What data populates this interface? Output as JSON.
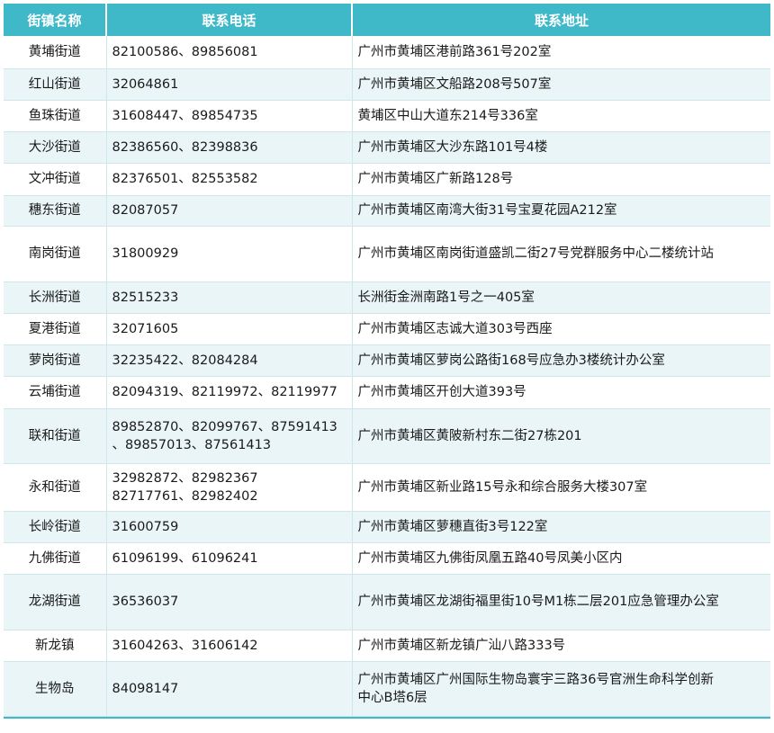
{
  "headers": [
    "街镇名称",
    "联系电话",
    "联系地址"
  ],
  "rows": [
    {
      "name": "黄埔街道",
      "phone": [
        "82100586、89856081"
      ],
      "addr": [
        "广州市黄埔区港前路361号202室"
      ],
      "h": 36
    },
    {
      "name": "红山街道",
      "phone": [
        "32064861"
      ],
      "addr": [
        "广州市黄埔区文船路208号507室"
      ],
      "h": 35
    },
    {
      "name": "鱼珠街道",
      "phone": [
        "31608447、89854735"
      ],
      "addr": [
        "黄埔区中山大道东214号336室"
      ],
      "h": 35
    },
    {
      "name": "大沙街道",
      "phone": [
        "82386560、82398836"
      ],
      "addr": [
        "广州市黄埔区大沙东路101号4楼"
      ],
      "h": 35
    },
    {
      "name": "文冲街道",
      "phone": [
        "82376501、82553582"
      ],
      "addr": [
        "广州市黄埔区广新路128号"
      ],
      "h": 36
    },
    {
      "name": "穗东街道",
      "phone": [
        "82087057"
      ],
      "addr": [
        "广州市黄埔区南湾大街31号宝夏花园A212室"
      ],
      "h": 34
    },
    {
      "name": "南岗街道",
      "phone": [
        "31800929"
      ],
      "addr": [
        "广州市黄埔区南岗街道盛凯二街27号党群服务中心二楼统计站"
      ],
      "h": 62
    },
    {
      "name": "长洲街道",
      "phone": [
        "82515233"
      ],
      "addr": [
        "长洲街金洲南路1号之一405室"
      ],
      "h": 35
    },
    {
      "name": "夏港街道",
      "phone": [
        "32071605"
      ],
      "addr": [
        "广州市黄埔区志诚大道303号西座"
      ],
      "h": 35
    },
    {
      "name": "萝岗街道",
      "phone": [
        "32235422、82084284"
      ],
      "addr": [
        "广州市黄埔区萝岗公路街168号应急办3楼统计办公室"
      ],
      "h": 35
    },
    {
      "name": "云埔街道",
      "phone": [
        "82094319、82119972、82119977"
      ],
      "addr": [
        "广州市黄埔区开创大道393号"
      ],
      "h": 36
    },
    {
      "name": "联和街道",
      "phone": [
        "89852870、82099767、87591413",
        "、89857013、87561413"
      ],
      "addr": [
        "广州市黄埔区黄陂新村东二街27栋201"
      ],
      "h": 61
    },
    {
      "name": "永和街道",
      "phone": [
        "32982872、82982367",
        "82717761、82982402"
      ],
      "addr": [
        "广州市黄埔区新业路15号永和综合服务大楼307室"
      ],
      "h": 53
    },
    {
      "name": "长岭街道",
      "phone": [
        "31600759"
      ],
      "addr": [
        "广州市黄埔区萝穗直街3号122室"
      ],
      "h": 35
    },
    {
      "name": "九佛街道",
      "phone": [
        "61096199、61096241"
      ],
      "addr": [
        "广州市黄埔区九佛街凤凰五路40号凤美小区内"
      ],
      "h": 35
    },
    {
      "name": "龙湖街道",
      "phone": [
        "36536037"
      ],
      "addr": [
        "广州市黄埔区龙湖街福里街10号M1栋二层201应急管理办公室"
      ],
      "h": 62
    },
    {
      "name": "新龙镇",
      "phone": [
        "31604263、31606142"
      ],
      "addr": [
        "广州市黄埔区新龙镇广汕八路333号"
      ],
      "h": 35
    },
    {
      "name": "生物岛",
      "phone": [
        "84098147"
      ],
      "addr": [
        "广州市黄埔区广州国际生物岛寰宇三路36号官洲生命科学创新",
        "中心B塔6层"
      ],
      "h": 61
    }
  ]
}
